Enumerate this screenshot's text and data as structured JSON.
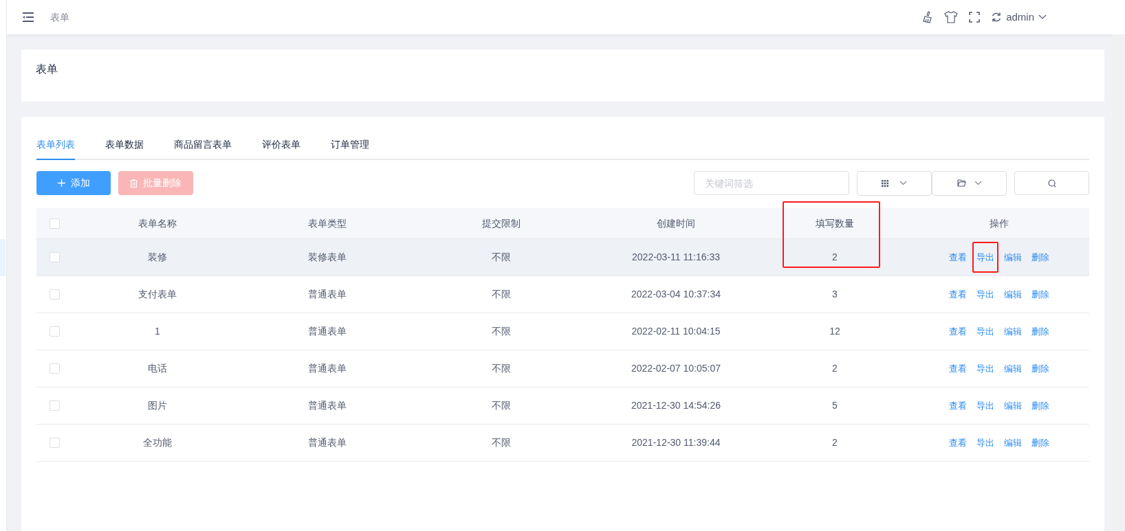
{
  "header": {
    "breadcrumb": "表单",
    "user": "admin"
  },
  "page_title": "表单",
  "tabs": [
    {
      "label": "表单列表",
      "selected": true
    },
    {
      "label": "表单数据",
      "selected": false
    },
    {
      "label": "商品留言表单",
      "selected": false
    },
    {
      "label": "评价表单",
      "selected": false
    },
    {
      "label": "订单管理",
      "selected": false
    }
  ],
  "toolbar": {
    "add_button": "添加",
    "batch_delete_button": "批量删除",
    "batch_delete_disabled": true,
    "search": {
      "placeholder": "关键词筛选"
    }
  },
  "table": {
    "header_checked": false,
    "count_column_marked": true,
    "columns": [
      "表单名称",
      "表单类型",
      "提交限制",
      "创建时间",
      "填写数量",
      "操作"
    ],
    "rows": [
      {
        "checked": false,
        "hovered": true,
        "cells": [
          "装修",
          "装修表单",
          "不限",
          "2022-03-11 11:16:33",
          "2"
        ],
        "actions": [
          "查看",
          "导出",
          "编辑",
          "删除"
        ],
        "export_marked": true
      },
      {
        "checked": false,
        "hovered": false,
        "cells": [
          "支付表单",
          "普通表单",
          "不限",
          "2022-03-04 10:37:34",
          "3"
        ],
        "actions": [
          "查看",
          "导出",
          "编辑",
          "删除"
        ],
        "export_marked": false
      },
      {
        "checked": false,
        "hovered": false,
        "cells": [
          "1",
          "普通表单",
          "不限",
          "2022-02-11 10:04:15",
          "12"
        ],
        "actions": [
          "查看",
          "导出",
          "编辑",
          "删除"
        ],
        "export_marked": false
      },
      {
        "checked": false,
        "hovered": false,
        "cells": [
          "电话",
          "普通表单",
          "不限",
          "2022-02-07 10:05:07",
          "2"
        ],
        "actions": [
          "查看",
          "导出",
          "编辑",
          "删除"
        ],
        "export_marked": false
      },
      {
        "checked": false,
        "hovered": false,
        "cells": [
          "图片",
          "普通表单",
          "不限",
          "2021-12-30 14:54:26",
          "5"
        ],
        "actions": [
          "查看",
          "导出",
          "编辑",
          "删除"
        ],
        "export_marked": false
      },
      {
        "checked": false,
        "hovered": false,
        "cells": [
          "全功能",
          "普通表单",
          "不限",
          "2021-12-30 11:39:44",
          "2"
        ],
        "actions": [
          "查看",
          "导出",
          "编辑",
          "删除"
        ],
        "export_marked": false
      }
    ]
  }
}
